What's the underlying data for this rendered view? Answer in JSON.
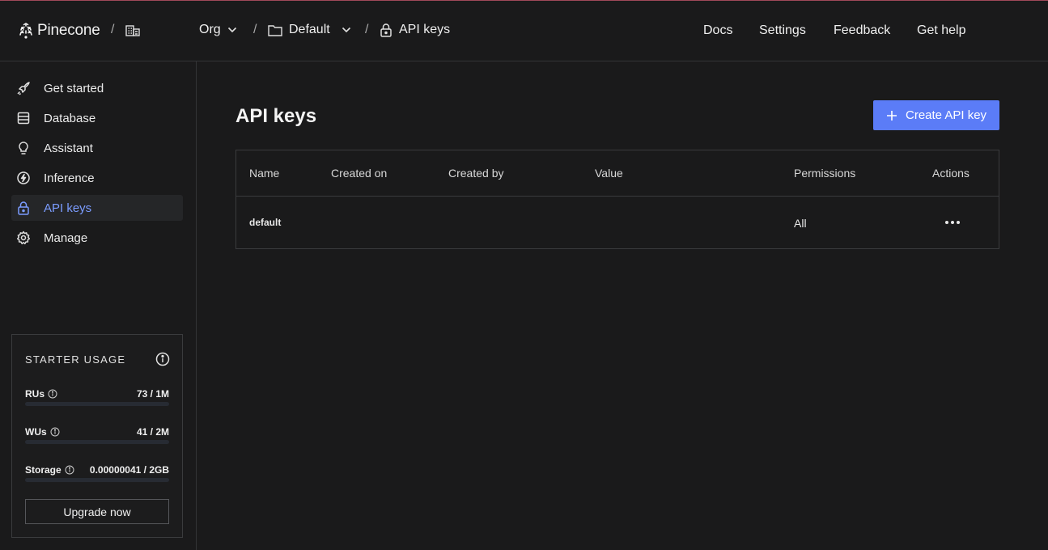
{
  "header": {
    "logo_text": "Pinecone",
    "breadcrumb_sep": "/",
    "org_label": "Org",
    "project_label": "Default",
    "page_label": "API keys",
    "nav": [
      "Docs",
      "Settings",
      "Feedback",
      "Get help"
    ]
  },
  "sidebar": {
    "items": [
      {
        "label": "Get started",
        "icon": "rocket-icon"
      },
      {
        "label": "Database",
        "icon": "database-icon"
      },
      {
        "label": "Assistant",
        "icon": "lightbulb-icon"
      },
      {
        "label": "Inference",
        "icon": "bolt-icon"
      },
      {
        "label": "API keys",
        "icon": "lock-icon",
        "active": true
      },
      {
        "label": "Manage",
        "icon": "gear-icon"
      }
    ],
    "usage": {
      "title": "STARTER USAGE",
      "rows": [
        {
          "label": "RUs",
          "value": "73 / 1M",
          "fraction": 7e-05
        },
        {
          "label": "WUs",
          "value": "41 / 2M",
          "fraction": 2e-05
        },
        {
          "label": "Storage",
          "value": "0.00000041 / 2GB",
          "fraction": 0.0
        }
      ],
      "upgrade_label": "Upgrade now"
    }
  },
  "main": {
    "title": "API keys",
    "create_label": "Create API key",
    "table": {
      "columns": [
        "Name",
        "Created on",
        "Created by",
        "Value",
        "Permissions",
        "Actions"
      ],
      "rows": [
        {
          "name": "default",
          "created_on": "",
          "created_by": "",
          "value": "",
          "permissions": "All"
        }
      ]
    }
  },
  "colors": {
    "accent": "#5b7cf7",
    "active_text": "#7b9cff",
    "background": "#1a1a1b",
    "border": "#333436"
  }
}
